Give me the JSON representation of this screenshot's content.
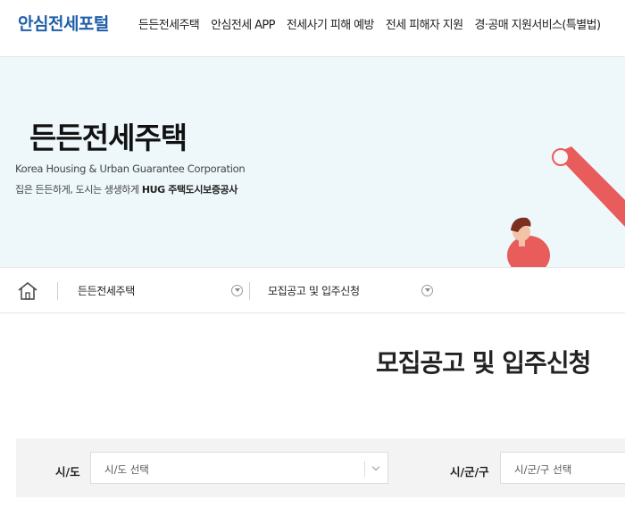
{
  "header": {
    "logo": "안심전세포털",
    "nav": [
      "든든전세주택",
      "안심전세 APP",
      "전세사기 피해 예방",
      "전세 피해자 지원",
      "경·공매 지원서비스(특별법)"
    ]
  },
  "hero": {
    "title": "든든전세주택",
    "subtitle_en": "Korea Housing & Urban Guarantee Corporation",
    "subtitle_ko_prefix": "집은 든든하게, 도시는 생생하게 ",
    "subtitle_ko_bold": "HUG 주택도시보증공사"
  },
  "breadcrumb": {
    "home_icon": "home-icon",
    "level1": "든든전세주택",
    "level2": "모집공고 및 입주신청"
  },
  "page": {
    "title": "모집공고 및 입주신청"
  },
  "filters": {
    "sido_label": "시/도",
    "sido_placeholder": "시/도 선택",
    "sigungu_label": "시/군/구",
    "sigungu_placeholder": "시/군/구 선택"
  },
  "colors": {
    "brand_blue": "#1f5fa9",
    "hero_bg": "#eef8fb",
    "accent_red": "#e85c5c"
  }
}
